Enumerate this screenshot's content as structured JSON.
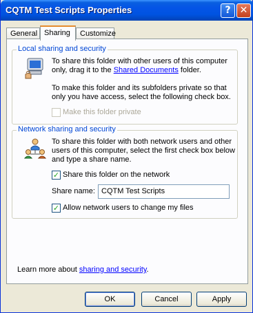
{
  "window": {
    "title": "CQTM Test Scripts Properties",
    "help_glyph": "?",
    "close_glyph": "✕",
    "accent_color": "#0454e6"
  },
  "tabs": [
    {
      "label": "General"
    },
    {
      "label": "Sharing",
      "selected": true
    },
    {
      "label": "Customize"
    }
  ],
  "local_sharing": {
    "title": "Local sharing and security",
    "icon": "shared-computer-icon",
    "line1": "To share this folder with other users of this computer",
    "line2_prefix": "only, drag it to the ",
    "line2_link": "Shared Documents",
    "line2_suffix": " folder.",
    "line3": "To make this folder and its subfolders private so that",
    "line4": "only you have access, select the following check box.",
    "make_private_label": "Make this folder private",
    "make_private_checked": false,
    "make_private_enabled": false
  },
  "network_sharing": {
    "title": "Network sharing and security",
    "icon": "network-users-icon",
    "line1": "To share this folder with both network users and other",
    "line2": "users of this computer, select the first check box below",
    "line3": "and type a share name.",
    "share_label": "Share this folder on the network",
    "share_checked": true,
    "share_name_label": "Share name:",
    "share_name_value": "CQTM Test Scripts",
    "allow_change_label": "Allow network users to change my files",
    "allow_change_checked": true
  },
  "footer": {
    "learn_prefix": "Learn more about ",
    "learn_link": "sharing and security",
    "learn_suffix": "."
  },
  "buttons": {
    "ok": "OK",
    "cancel": "Cancel",
    "apply": "Apply"
  }
}
